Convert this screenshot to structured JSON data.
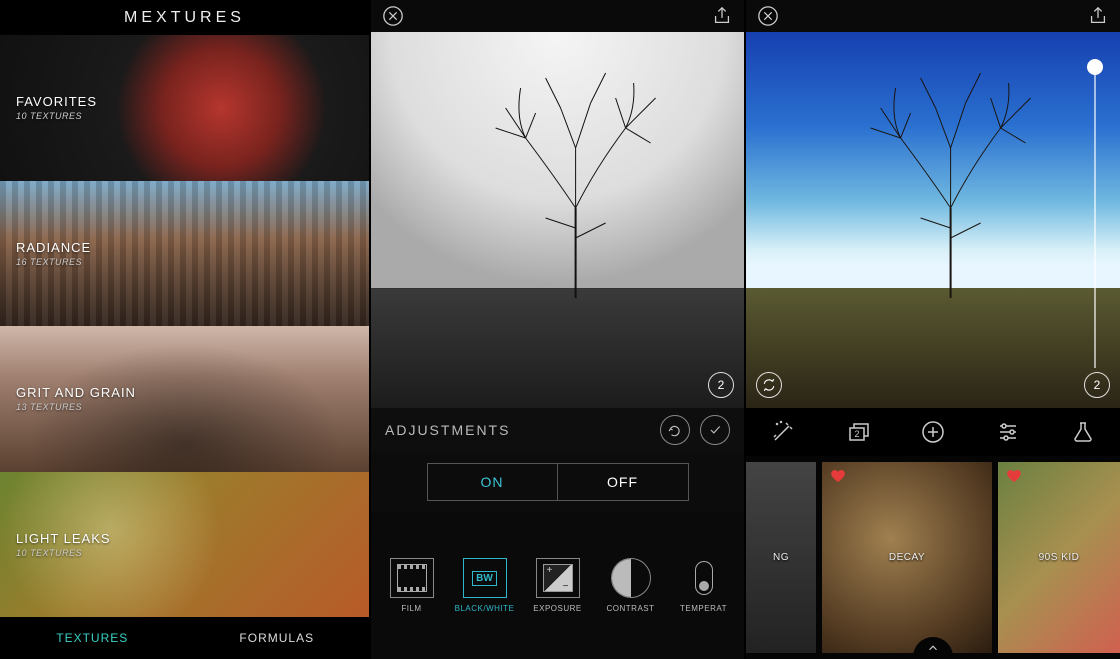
{
  "screen1": {
    "title": "MEXTURES",
    "items": [
      {
        "title": "FAVORITES",
        "sub": "10 TEXTURES"
      },
      {
        "title": "RADIANCE",
        "sub": "16 TEXTURES"
      },
      {
        "title": "GRIT AND GRAIN",
        "sub": "13 TEXTURES"
      },
      {
        "title": "LIGHT LEAKS",
        "sub": "10 TEXTURES"
      }
    ],
    "tabs": {
      "textures": "TEXTURES",
      "formulas": "FORMULAS",
      "active": "textures"
    }
  },
  "screen2": {
    "layer_count": "2",
    "adjustments_label": "ADJUSTMENTS",
    "toggle": {
      "on": "ON",
      "off": "OFF",
      "active": "on"
    },
    "strip": {
      "film": "FILM",
      "bw": "BLACK/WHITE",
      "bw_tag": "BW",
      "exposure": "EXPOSURE",
      "contrast": "CONTRAST",
      "temperature": "TEMPERAT"
    }
  },
  "screen3": {
    "layer_count": "2",
    "toolbar_layer_num": "2",
    "thumbs": {
      "left": "NG",
      "center": "DECAY",
      "right": "90S KID"
    }
  }
}
